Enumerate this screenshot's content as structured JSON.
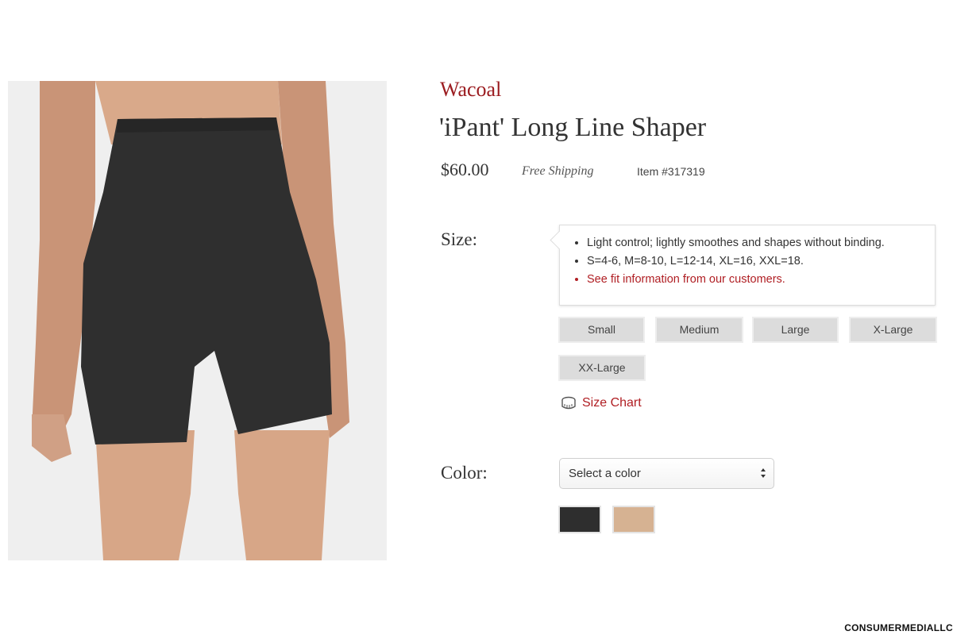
{
  "product": {
    "brand": "Wacoal",
    "title": "'iPant' Long Line Shaper",
    "price": "$60.00",
    "shipping": "Free Shipping",
    "item_number": "Item #317319"
  },
  "size": {
    "label": "Size:",
    "info": [
      "Light control; lightly smoothes and shapes without binding.",
      "S=4-6, M=8-10, L=12-14, XL=16, XXL=18.",
      "See fit information from our customers."
    ],
    "options": [
      "Small",
      "Medium",
      "Large",
      "X-Large",
      "XX-Large"
    ],
    "size_chart_label": "Size Chart",
    "size_chart_icon": "tape-measure-icon"
  },
  "color": {
    "label": "Color:",
    "select_value": "Select a color",
    "swatches": [
      {
        "name": "Black",
        "hex": "#2e2e2e"
      },
      {
        "name": "Nude",
        "hex": "#d6b292"
      }
    ]
  },
  "watermark": "CONSUMERMEDIALLC",
  "colors": {
    "brand_red": "#9b1c20",
    "link_red": "#b01e23"
  }
}
